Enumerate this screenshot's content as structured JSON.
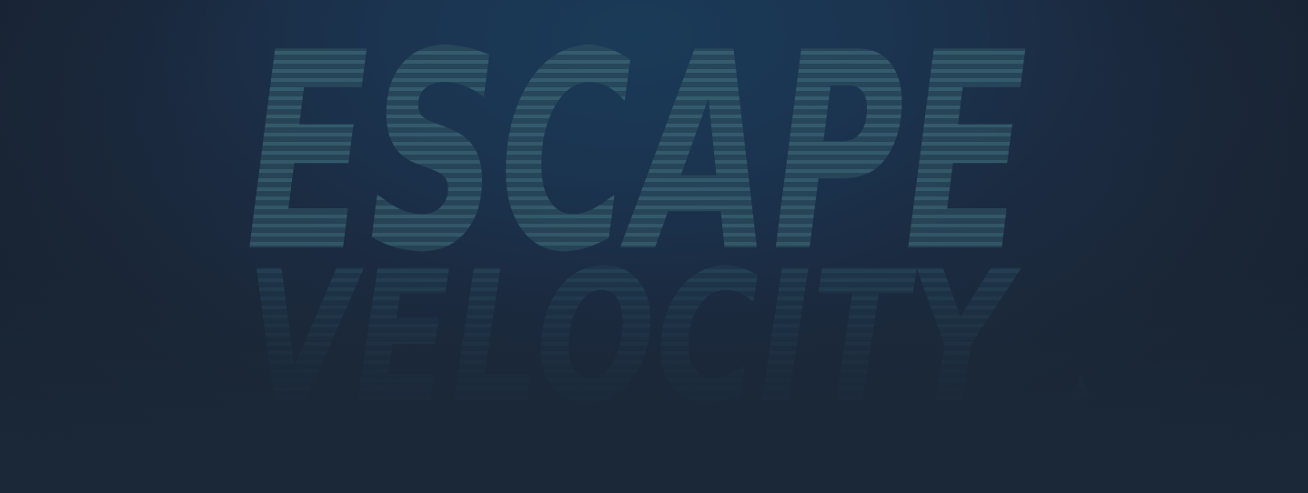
{
  "logo": {
    "line1": "ESCAPE",
    "line2": "VELOCITY"
  },
  "colors": {
    "background": "#1b2838",
    "glow": "#1a3b58",
    "letter": "#2a4a5a",
    "stripe": "#3a6070"
  }
}
